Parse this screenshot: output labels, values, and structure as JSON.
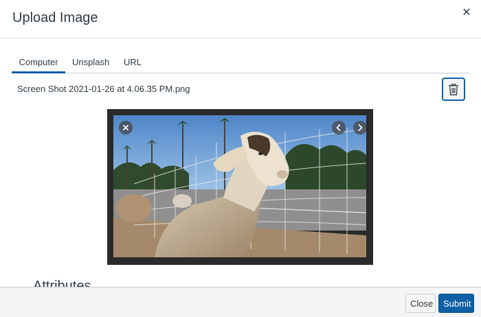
{
  "dialog": {
    "title": "Upload Image",
    "close_icon": "close-icon"
  },
  "tabs": [
    {
      "label": "Computer",
      "active": true
    },
    {
      "label": "Unsplash",
      "active": false
    },
    {
      "label": "URL",
      "active": false
    }
  ],
  "file": {
    "name": "Screen Shot 2021-01-26 at 4.06.35 PM.png",
    "delete_icon": "trash-icon"
  },
  "preview": {
    "remove_icon": "close-circle-icon",
    "prev_icon": "chevron-left-icon",
    "next_icon": "chevron-right-icon"
  },
  "attributes": {
    "heading": "Attributes"
  },
  "footer": {
    "close_label": "Close",
    "submit_label": "Submit"
  },
  "colors": {
    "accent": "#0e5fa6",
    "text": "#2d3b45",
    "footer_bg": "#f5f5f5"
  }
}
